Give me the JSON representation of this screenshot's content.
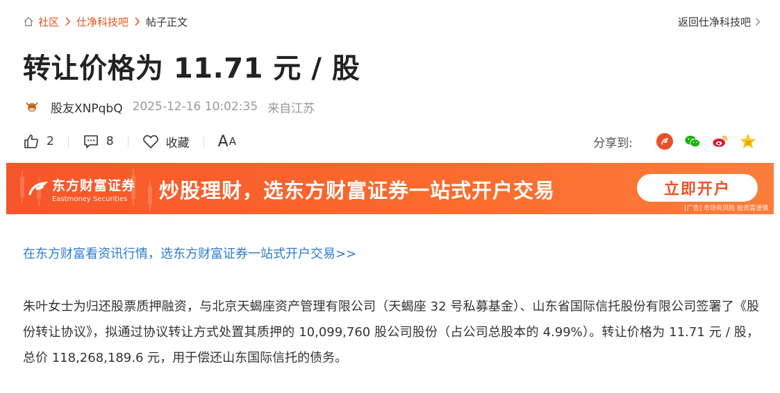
{
  "breadcrumb": {
    "items": [
      {
        "label": "社区"
      },
      {
        "label": "仕净科技吧"
      }
    ],
    "current": "帖子正文",
    "back_label": "返回仕净科技吧"
  },
  "post": {
    "title": "转让价格为 11.71 元 / 股",
    "author": "股友XNPqbQ",
    "time": "2025-12-16 10:02:35",
    "location": "来自江苏"
  },
  "actions": {
    "like_count": "2",
    "comment_count": "8",
    "favorite_label": "收藏",
    "font_label_big": "A",
    "font_label_small": "A"
  },
  "share": {
    "label": "分享到:",
    "icons": [
      "guba-share-icon",
      "wechat-icon",
      "weibo-icon",
      "qzone-icon"
    ]
  },
  "banner": {
    "logo_cn": "东方财富证券",
    "logo_en": "Eastmoney Securities",
    "slogan": "炒股理财，选东方财富证券一站式开户交易",
    "cta": "立即开户",
    "note": "[广告] 市场有风险 投资需谨慎"
  },
  "promo_link": "在东方财富看资讯行情，选东方财富证券一站式开户交易>>",
  "content": "朱叶女士为归还股票质押融资，与北京天蝎座资产管理有限公司（天蝎座 32 号私募基金）、山东省国际信托股份有限公司签署了《股份转让协议》，拟通过协议转让方式处置其质押的 10,099,760 股公司股份（占公司总股本的 4.99%）。转让价格为 11.71 元 / 股，总价 118,268,189.6 元，用于偿还山东国际信托的债务。",
  "colors": {
    "accent": "#e4541d",
    "link": "#2d7bd3",
    "banner": "#f7552a"
  }
}
